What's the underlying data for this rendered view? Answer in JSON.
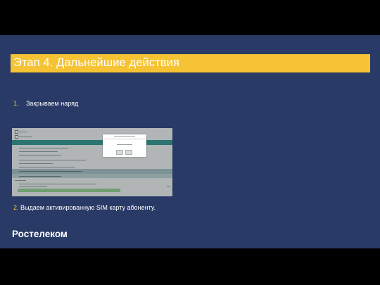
{
  "slide": {
    "title": "Этап  4. Дальнейшие действия",
    "steps": [
      {
        "num": "1.",
        "text": "Закрываем наряд"
      },
      {
        "num": "2.",
        "text": "Выдаем активированную SIM карту абоненту."
      }
    ],
    "brand": "Ростелеком"
  },
  "colors": {
    "background": "#2a3a66",
    "accent": "#f5c333",
    "text": "#ffffff",
    "letterbox": "#000000"
  },
  "screenshot": {
    "description_icon": "ui-screenshot-thumbnail",
    "modal_buttons": [
      "ok-button",
      "cancel-button"
    ]
  }
}
